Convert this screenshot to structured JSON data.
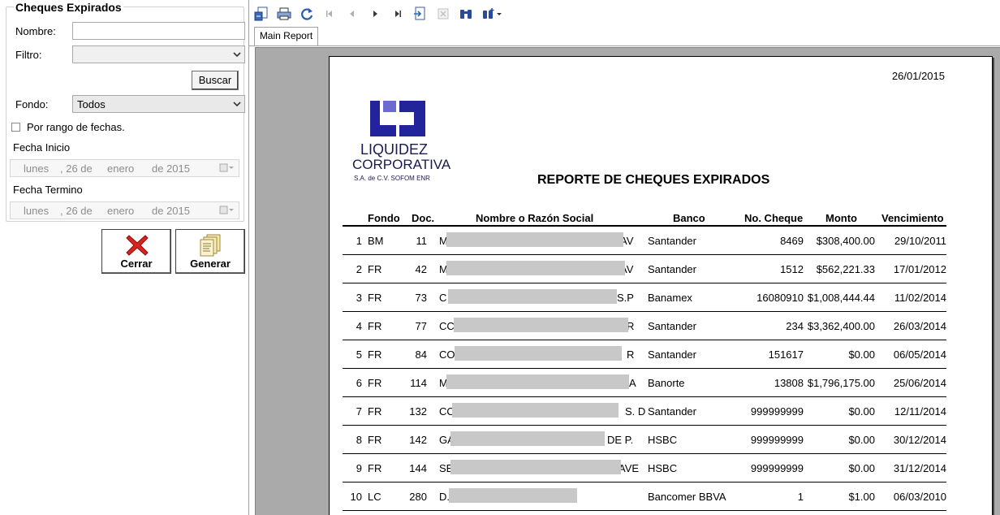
{
  "left_panel": {
    "group_title": "Cheques Expirados",
    "nombre_label": "Nombre:",
    "nombre_value": "",
    "filtro_label": "Filtro:",
    "filtro_value": "",
    "buscar_label": "Buscar",
    "fondo_label": "Fondo:",
    "fondo_value": "Todos",
    "rango_label": "Por rango de fechas.",
    "rango_checked": false,
    "fecha_inicio_label": "Fecha Inicio",
    "fecha_inicio": {
      "dow": "lunes",
      "day": ", 26 de",
      "month": "enero",
      "year": "de 2015"
    },
    "fecha_termino_label": "Fecha Termino",
    "fecha_termino": {
      "dow": "lunes",
      "day": ", 26 de",
      "month": "enero",
      "year": "de 2015"
    },
    "cerrar_label": "Cerrar",
    "generar_label": "Generar"
  },
  "viewer": {
    "toolbar_icons": [
      "export-icon",
      "print-icon",
      "refresh-icon",
      "first-page-icon",
      "prev-page-icon",
      "next-page-icon",
      "last-page-icon",
      "goto-page-icon",
      "close-view-icon",
      "find-icon",
      "zoom-icon"
    ],
    "tab_label": "Main Report"
  },
  "report": {
    "date": "26/01/2015",
    "logo_line1": "LIQUIDEZ",
    "logo_line2": "CORPORATIVA",
    "logo_line3": "S.A. de C.V. SOFOM ENR",
    "title": "REPORTE DE CHEQUES EXPIRADOS",
    "headers": {
      "fondo": "Fondo",
      "doc": "Doc.",
      "nombre": "Nombre o Razón Social",
      "banco": "Banco",
      "cheque": "No. Cheque",
      "monto": "Monto",
      "venc": "Vencimiento"
    },
    "rows": [
      {
        "n": "1",
        "fondo": "BM",
        "doc": "11",
        "pre": "M",
        "post": "AV",
        "banco": "Santander",
        "cheque": "8469",
        "monto": "$308,400.00",
        "venc": "29/10/2011"
      },
      {
        "n": "2",
        "fondo": "FR",
        "doc": "42",
        "pre": "M",
        "post": "AV",
        "banco": "Santander",
        "cheque": "1512",
        "monto": "$562,221.33",
        "venc": "17/01/2012"
      },
      {
        "n": "3",
        "fondo": "FR",
        "doc": "73",
        "pre": "C",
        "post": "S.P",
        "banco": "Banamex",
        "cheque": "16080910",
        "monto": "$1,008,444.44",
        "venc": "11/02/2014"
      },
      {
        "n": "4",
        "fondo": "FR",
        "doc": "77",
        "pre": "CC",
        "post": "R",
        "banco": "Santander",
        "cheque": "234",
        "monto": "$3,362,400.00",
        "venc": "26/03/2014"
      },
      {
        "n": "5",
        "fondo": "FR",
        "doc": "84",
        "pre": "CO",
        "post": "R",
        "banco": "Santander",
        "cheque": "151617",
        "monto": "$0.00",
        "venc": "06/05/2014"
      },
      {
        "n": "6",
        "fondo": "FR",
        "doc": "114",
        "pre": "M",
        "post": "A",
        "banco": "Banorte",
        "cheque": "13808",
        "monto": "$1,796,175.00",
        "venc": "25/06/2014"
      },
      {
        "n": "7",
        "fondo": "FR",
        "doc": "132",
        "pre": "CO",
        "post": "S. D",
        "banco": "Santander",
        "cheque": "999999999",
        "monto": "$0.00",
        "venc": "12/11/2014"
      },
      {
        "n": "8",
        "fondo": "FR",
        "doc": "142",
        "pre": "GA",
        "post": "DE P.",
        "banco": "HSBC",
        "cheque": "999999999",
        "monto": "$0.00",
        "venc": "30/12/2014"
      },
      {
        "n": "9",
        "fondo": "FR",
        "doc": "144",
        "pre": "SE",
        "post": "AVE",
        "banco": "HSBC",
        "cheque": "999999999",
        "monto": "$0.00",
        "venc": "31/12/2014"
      },
      {
        "n": "10",
        "fondo": "LC",
        "doc": "280",
        "pre": "D.",
        "post": "",
        "banco": "Bancomer BBVA",
        "cheque": "1",
        "monto": "$1.00",
        "venc": "06/03/2010"
      }
    ]
  },
  "colors": {
    "logo_blue": "#23239a",
    "redaction": "#c8c8c8",
    "viewer_bg": "#aaaaaa"
  }
}
